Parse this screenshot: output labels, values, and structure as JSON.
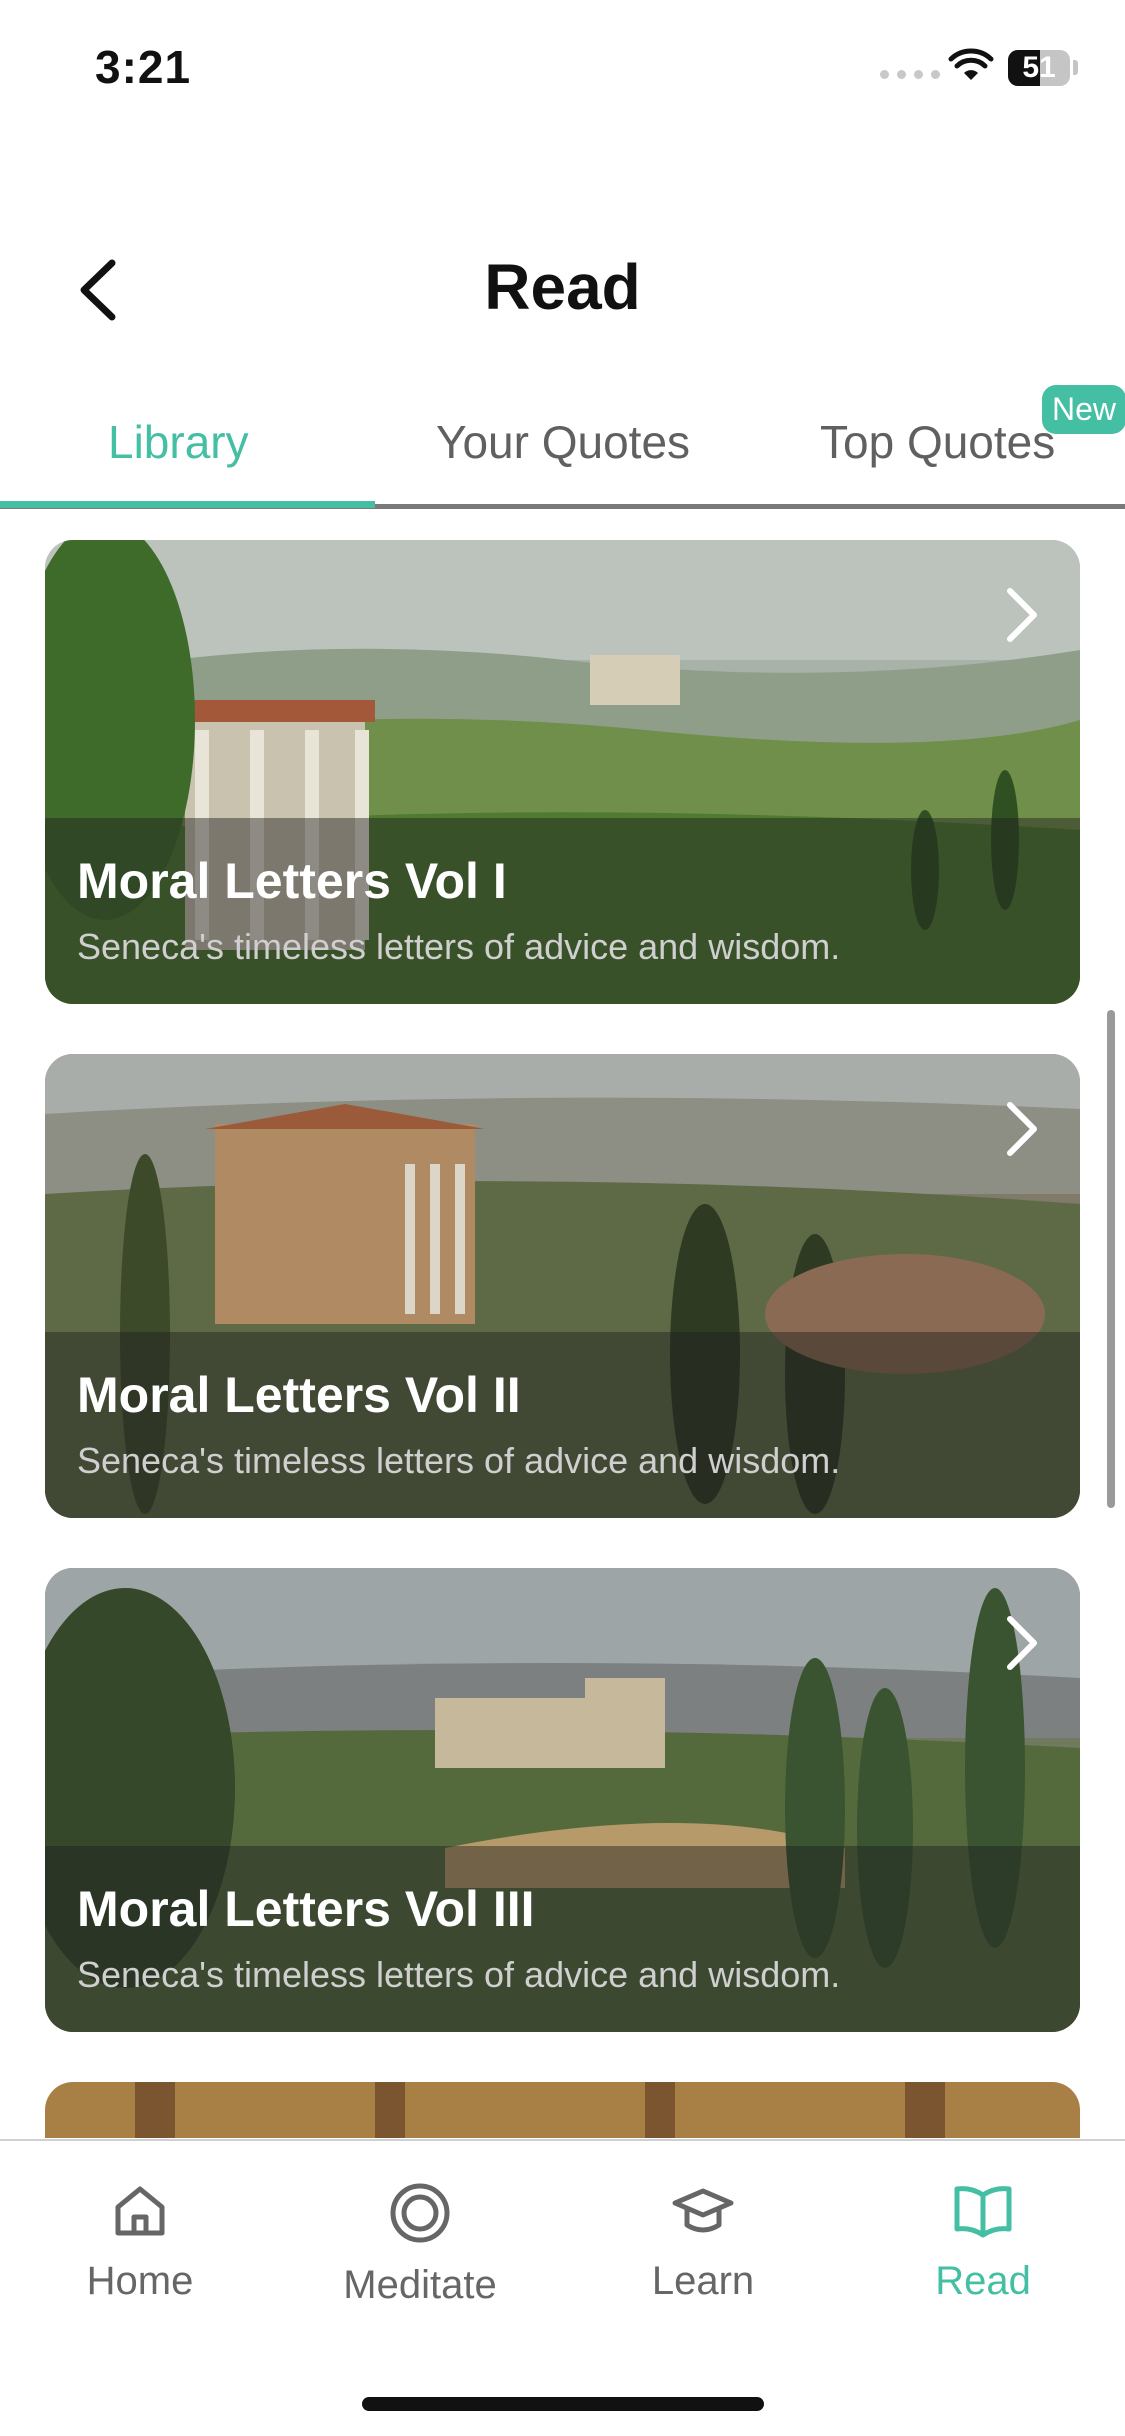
{
  "status_bar": {
    "time": "3:21",
    "battery": "51"
  },
  "header": {
    "title": "Read"
  },
  "tabs": [
    {
      "label": "Library",
      "active": true
    },
    {
      "label": "Your Quotes",
      "active": false
    },
    {
      "label": "Top Quotes",
      "active": false,
      "badge": "New"
    }
  ],
  "library": [
    {
      "title": "Moral Letters Vol I",
      "subtitle": "Seneca's timeless letters of advice and wisdom."
    },
    {
      "title": "Moral Letters Vol II",
      "subtitle": "Seneca's timeless letters of advice and wisdom."
    },
    {
      "title": "Moral Letters Vol III",
      "subtitle": "Seneca's timeless letters of advice and wisdom."
    }
  ],
  "bottom_nav": [
    {
      "label": "Home",
      "icon": "home-icon",
      "active": false
    },
    {
      "label": "Meditate",
      "icon": "meditate-icon",
      "active": false
    },
    {
      "label": "Learn",
      "icon": "graduation-cap-icon",
      "active": false
    },
    {
      "label": "Read",
      "icon": "open-book-icon",
      "active": true
    }
  ],
  "colors": {
    "accent": "#45bfa4",
    "text": "#111111",
    "muted": "#606060"
  }
}
